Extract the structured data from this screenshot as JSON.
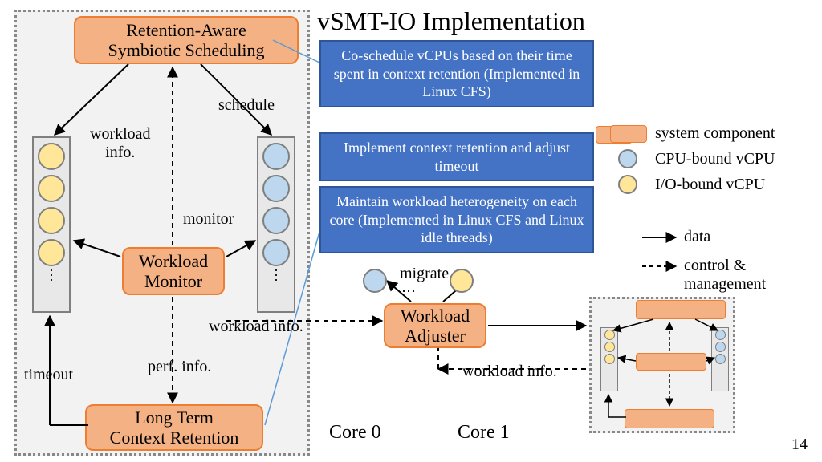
{
  "title": "vSMT-IO Implementation",
  "slide_number": "14",
  "components": {
    "scheduler": "Retention-Aware\nSymbiotic Scheduling",
    "monitor": "Workload\nMonitor",
    "retention": "Long Term\nContext Retention",
    "adjuster": "Workload\nAdjuster"
  },
  "callouts": {
    "c1": "Co-schedule vCPUs based on their time spent in context retention (Implemented in Linux CFS)",
    "c2": "Implement context retention and adjust timeout",
    "c3": "Maintain workload heterogeneity on each core (Implemented in Linux CFS and Linux idle threads)"
  },
  "edge_labels": {
    "schedule": "schedule",
    "workload_info_left": "workload\ninfo.",
    "monitor": "monitor",
    "timeout": "timeout",
    "perf_info": "perf. info.",
    "workload_info_mid": "workload info.",
    "workload_info_right": "workload info.",
    "migrate": "migrate"
  },
  "cores": {
    "c0": "Core 0",
    "c1": "Core 1"
  },
  "legend": {
    "system_component": "system component",
    "cpu_bound": "CPU-bound vCPU",
    "io_bound": "I/O-bound vCPU",
    "data": "data",
    "control": "control & management"
  }
}
